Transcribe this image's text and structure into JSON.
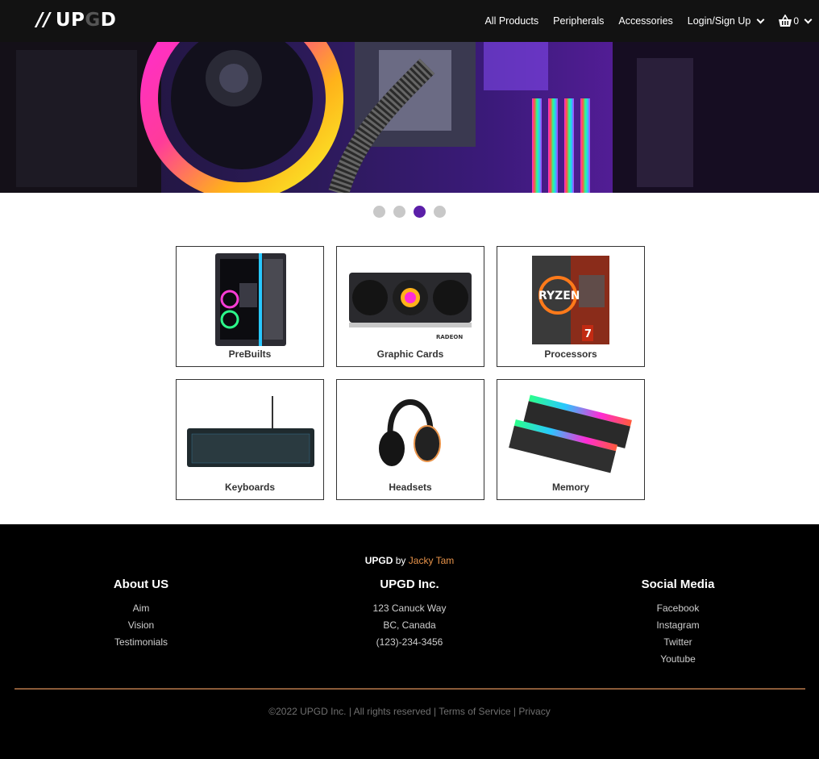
{
  "brand": {
    "slash": "//",
    "pre": "UP",
    "g": "G",
    "post": "D"
  },
  "nav": {
    "links": [
      "All Products",
      "Peripherals",
      "Accessories"
    ],
    "account_label": "Login/Sign Up",
    "cart_count": "0"
  },
  "carousel": {
    "total_slides": 4,
    "active_index": 2
  },
  "categories": [
    {
      "label": "PreBuilts",
      "icon": "prebuilt-pc-image"
    },
    {
      "label": "Graphic Cards",
      "icon": "graphics-card-image"
    },
    {
      "label": "Processors",
      "icon": "ryzen-processor-box-image"
    },
    {
      "label": "Keyboards",
      "icon": "keyboard-image"
    },
    {
      "label": "Headsets",
      "icon": "headset-image"
    },
    {
      "label": "Memory",
      "icon": "ram-memory-image"
    }
  ],
  "footer": {
    "brand_name": "UPGD",
    "by_text": "by",
    "author": "Jacky Tam",
    "about": {
      "title": "About US",
      "items": [
        "Aim",
        "Vision",
        "Testimonials"
      ]
    },
    "company": {
      "title": "UPGD Inc.",
      "items": [
        "123 Canuck Way",
        "BC, Canada",
        "(123)-234-3456"
      ]
    },
    "social": {
      "title": "Social Media",
      "items": [
        "Facebook",
        "Instagram",
        "Twitter",
        "Youtube"
      ]
    },
    "copyright": "©2022 UPGD Inc. | All rights reserved |",
    "terms": "Terms of Service",
    "separator": "|",
    "privacy": "Privacy"
  },
  "colors": {
    "accent": "#5b1fa8",
    "footer_author": "#e8934a",
    "divider": "#8a5a38"
  }
}
